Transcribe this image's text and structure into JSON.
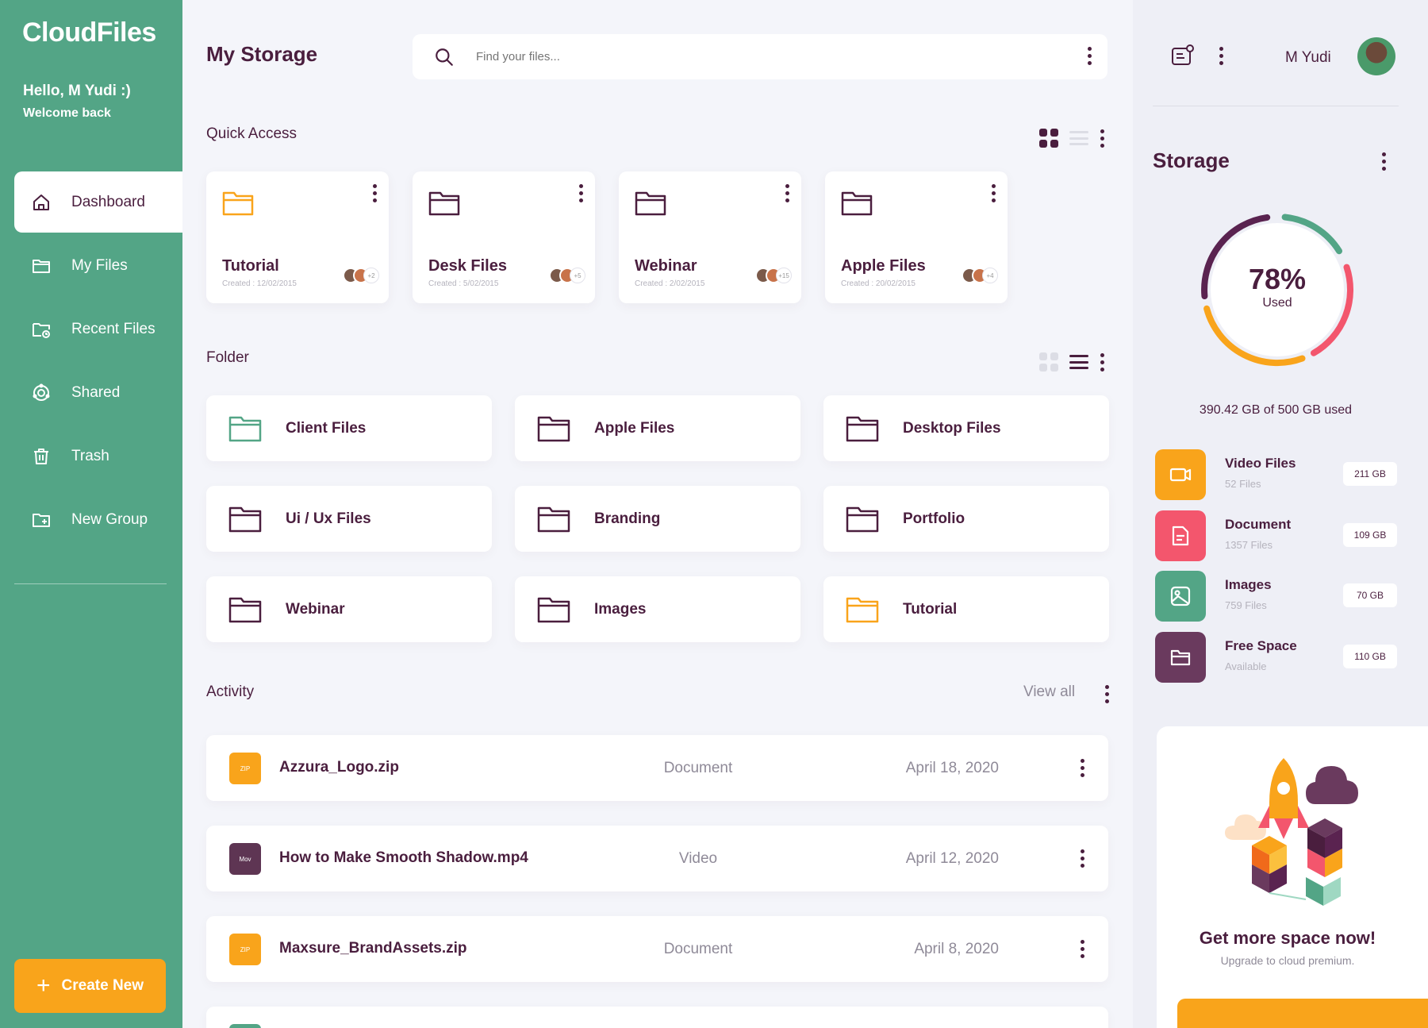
{
  "app": {
    "logo": "CloudFiles",
    "greeting": "Hello, M Yudi :)",
    "welcome": "Welcome back"
  },
  "sidebar": {
    "items": [
      {
        "label": "Dashboard",
        "icon": "home-icon",
        "active": true
      },
      {
        "label": "My Files",
        "icon": "folder-icon",
        "active": false
      },
      {
        "label": "Recent Files",
        "icon": "recent-folder-icon",
        "active": false
      },
      {
        "label": "Shared",
        "icon": "shared-icon",
        "active": false
      },
      {
        "label": "Trash",
        "icon": "trash-icon",
        "active": false
      },
      {
        "label": "New Group",
        "icon": "add-folder-icon",
        "active": false
      }
    ],
    "create_button": "Create New"
  },
  "header": {
    "title": "My Storage",
    "search_placeholder": "Find your files..."
  },
  "quick_access": {
    "title": "Quick Access",
    "cards": [
      {
        "name": "Tutorial",
        "created": "Created : 12/02/2015",
        "extra_members": "+2",
        "color": "#f9a41b"
      },
      {
        "name": "Desk Files",
        "created": "Created : 5/02/2015",
        "extra_members": "+5",
        "color": "#4a1e3e"
      },
      {
        "name": "Webinar",
        "created": "Created : 2/02/2015",
        "extra_members": "+15",
        "color": "#4a1e3e"
      },
      {
        "name": "Apple Files",
        "created": "Created : 20/02/2015",
        "extra_members": "+4",
        "color": "#4a1e3e"
      }
    ]
  },
  "folders": {
    "title": "Folder",
    "items": [
      {
        "name": "Client Files",
        "color": "#53a586"
      },
      {
        "name": "Apple Files",
        "color": "#4a1e3e"
      },
      {
        "name": "Desktop Files",
        "color": "#4a1e3e"
      },
      {
        "name": "Ui / Ux Files",
        "color": "#4a1e3e"
      },
      {
        "name": "Branding",
        "color": "#4a1e3e"
      },
      {
        "name": "Portfolio",
        "color": "#4a1e3e"
      },
      {
        "name": "Webinar",
        "color": "#4a1e3e"
      },
      {
        "name": "Images",
        "color": "#4a1e3e"
      },
      {
        "name": "Tutorial",
        "color": "#f9a41b"
      }
    ]
  },
  "activity": {
    "title": "Activity",
    "view_all": "View all",
    "rows": [
      {
        "badge": "ZIP",
        "badge_color": "#f9a41b",
        "name": "Azzura_Logo.zip",
        "type": "Document",
        "date": "April 18, 2020"
      },
      {
        "badge": "Mov",
        "badge_color": "#5e3553",
        "name": "How to Make Smooth Shadow.mp4",
        "type": "Video",
        "date": "April 12, 2020"
      },
      {
        "badge": "ZIP",
        "badge_color": "#f9a41b",
        "name": "Maxsure_BrandAssets.zip",
        "type": "Document",
        "date": "April 8, 2020"
      }
    ]
  },
  "user": {
    "name": "M Yudi"
  },
  "storage": {
    "title": "Storage",
    "percent_label": "78%",
    "used_label": "Used",
    "percent_used": 0.78,
    "summary": "390.42 GB of 500 GB used",
    "categories": [
      {
        "name": "Video Files",
        "sub": "52 Files",
        "size": "211 GB",
        "color": "#f9a41b",
        "icon": "video-icon"
      },
      {
        "name": "Document",
        "sub": "1357 Files",
        "size": "109 GB",
        "color": "#f3566d",
        "icon": "document-icon"
      },
      {
        "name": "Images",
        "sub": "759 Files",
        "size": "70 GB",
        "color": "#53a586",
        "icon": "image-icon"
      },
      {
        "name": "Free Space",
        "sub": "Available",
        "size": "110 GB",
        "color": "#6a3a5e",
        "icon": "folder-icon"
      }
    ]
  },
  "promo": {
    "title": "Get more space now!",
    "subtitle": "Upgrade to cloud premium."
  }
}
